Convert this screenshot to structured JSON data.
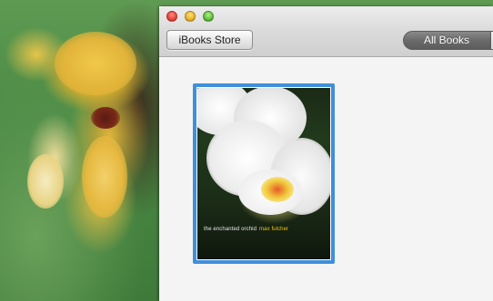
{
  "window": {
    "store_button_label": "iBooks Store",
    "library_tabs": [
      {
        "label": "All Books",
        "selected": true
      }
    ]
  },
  "library": {
    "books": [
      {
        "title": "the enchanted orchid",
        "author": "max fulcher",
        "selected": true
      }
    ]
  },
  "colors": {
    "selection_border": "#3f8fdb",
    "author_text": "#f2c318"
  }
}
